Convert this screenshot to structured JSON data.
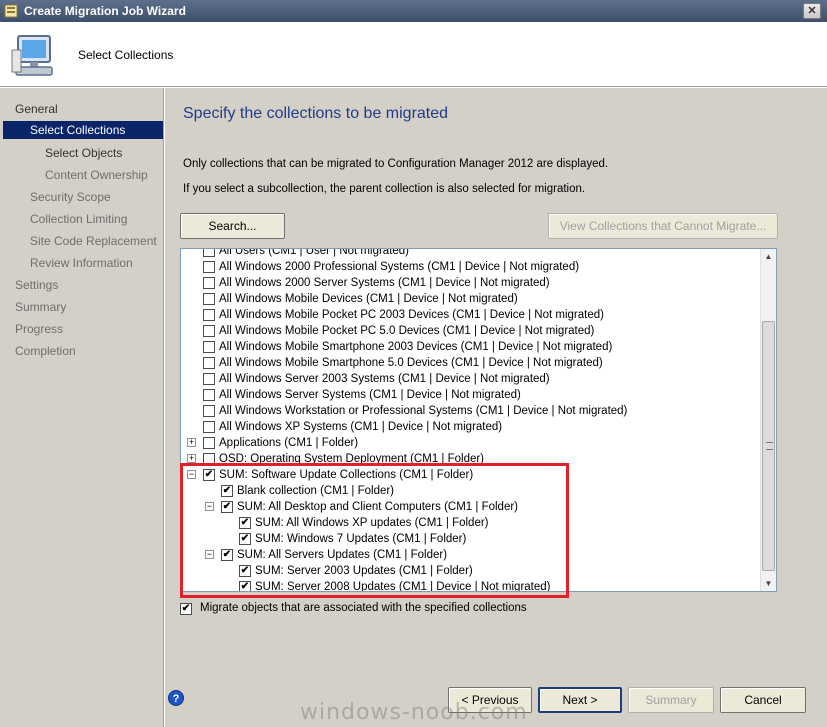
{
  "window": {
    "title": "Create Migration Job Wizard",
    "close_label": "✕"
  },
  "header": {
    "step_title": "Select Collections"
  },
  "sidebar": {
    "items": [
      {
        "label": "General"
      },
      {
        "label": "Select Collections"
      },
      {
        "label": "Select Objects"
      },
      {
        "label": "Content Ownership"
      },
      {
        "label": "Security Scope"
      },
      {
        "label": "Collection Limiting"
      },
      {
        "label": "Site Code Replacement"
      },
      {
        "label": "Review Information"
      },
      {
        "label": "Settings"
      },
      {
        "label": "Summary"
      },
      {
        "label": "Progress"
      },
      {
        "label": "Completion"
      }
    ]
  },
  "main": {
    "heading": "Specify the collections to be migrated",
    "info_line1": "Only collections that can be migrated to Configuration Manager 2012 are displayed.",
    "info_line2": "If you select a subcollection, the parent collection is also selected for migration.",
    "search_button": "Search...",
    "view_cannot_migrate_button": "View Collections that Cannot Migrate...",
    "tree_items": [
      {
        "label": "All Users (CM1 | User | Not migrated)",
        "checked": false,
        "expander": ""
      },
      {
        "label": "All Windows 2000 Professional Systems (CM1 | Device | Not migrated)",
        "checked": false,
        "expander": ""
      },
      {
        "label": "All Windows 2000 Server Systems (CM1 | Device | Not migrated)",
        "checked": false,
        "expander": ""
      },
      {
        "label": "All Windows Mobile Devices (CM1 | Device | Not migrated)",
        "checked": false,
        "expander": ""
      },
      {
        "label": "All Windows Mobile Pocket PC 2003 Devices (CM1 | Device | Not migrated)",
        "checked": false,
        "expander": ""
      },
      {
        "label": "All Windows Mobile Pocket PC 5.0 Devices (CM1 | Device | Not migrated)",
        "checked": false,
        "expander": ""
      },
      {
        "label": "All Windows Mobile Smartphone 2003 Devices (CM1 | Device | Not migrated)",
        "checked": false,
        "expander": ""
      },
      {
        "label": "All Windows Mobile Smartphone 5.0 Devices (CM1 | Device | Not migrated)",
        "checked": false,
        "expander": ""
      },
      {
        "label": "All Windows Server 2003 Systems (CM1 | Device | Not migrated)",
        "checked": false,
        "expander": ""
      },
      {
        "label": "All Windows Server Systems (CM1 | Device | Not migrated)",
        "checked": false,
        "expander": ""
      },
      {
        "label": "All Windows Workstation or Professional Systems (CM1 | Device | Not migrated)",
        "checked": false,
        "expander": ""
      },
      {
        "label": "All Windows XP Systems (CM1 | Device | Not migrated)",
        "checked": false,
        "expander": ""
      },
      {
        "label": "Applications (CM1 | Folder)",
        "checked": false,
        "expander": "+"
      },
      {
        "label": "OSD: Operating System Deployment (CM1 | Folder)",
        "checked": false,
        "expander": "+"
      },
      {
        "label": "SUM: Software Update Collections (CM1 | Folder)",
        "checked": true,
        "expander": "−"
      },
      {
        "label": "Blank collection (CM1 | Folder)",
        "checked": true,
        "expander": ""
      },
      {
        "label": "SUM: All Desktop and Client Computers (CM1 | Folder)",
        "checked": true,
        "expander": "−"
      },
      {
        "label": "SUM: All Windows XP updates (CM1 | Folder)",
        "checked": true,
        "expander": ""
      },
      {
        "label": "SUM: Windows 7 Updates (CM1 | Folder)",
        "checked": true,
        "expander": ""
      },
      {
        "label": "SUM: All Servers Updates (CM1 | Folder)",
        "checked": true,
        "expander": "−"
      },
      {
        "label": "SUM: Server 2003 Updates (CM1 | Folder)",
        "checked": true,
        "expander": ""
      },
      {
        "label": "SUM: Server 2008 Updates (CM1 | Device | Not migrated)",
        "checked": true,
        "expander": ""
      }
    ],
    "migrate_checkbox_label": "Migrate objects that are associated with the specified collections",
    "migrate_checked": true
  },
  "footer": {
    "help_label": "?",
    "previous_button": "< Previous",
    "next_button": "Next >",
    "summary_button": "Summary",
    "cancel_button": "Cancel"
  },
  "watermark": "windows-noob.com",
  "colors": {
    "title_bar": "#3d4f6b",
    "selected_nav": "#0a246a",
    "heading": "#1f3c88",
    "highlight_border": "#e0202a"
  }
}
